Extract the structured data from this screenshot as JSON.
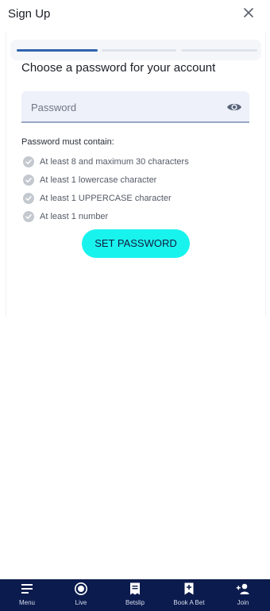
{
  "header": {
    "title": "Sign Up",
    "close_icon": "close-icon"
  },
  "progress": {
    "steps": 3,
    "current_step": 1,
    "accent": "#2f64ad"
  },
  "form": {
    "heading": "Choose a password for your account",
    "password_placeholder": "Password",
    "password_value": "",
    "requirements_title": "Password must contain:",
    "requirements": [
      {
        "label": "At least 8 and maximum 30 characters",
        "met": true
      },
      {
        "label": "At least 1 lowercase character",
        "met": true
      },
      {
        "label": "At least 1 UPPERCASE character",
        "met": true
      },
      {
        "label": "At least 1 number",
        "met": true
      }
    ],
    "submit_label": "SET PASSWORD",
    "button_color": "#19f3ee"
  },
  "bottom_nav": {
    "background": "#0b1b4d",
    "items": [
      {
        "label": "Menu",
        "icon": "menu-icon"
      },
      {
        "label": "Live",
        "icon": "live-icon"
      },
      {
        "label": "Betslip",
        "icon": "betslip-icon"
      },
      {
        "label": "Book A Bet",
        "icon": "book-a-bet-icon"
      },
      {
        "label": "Join",
        "icon": "join-icon"
      }
    ]
  }
}
